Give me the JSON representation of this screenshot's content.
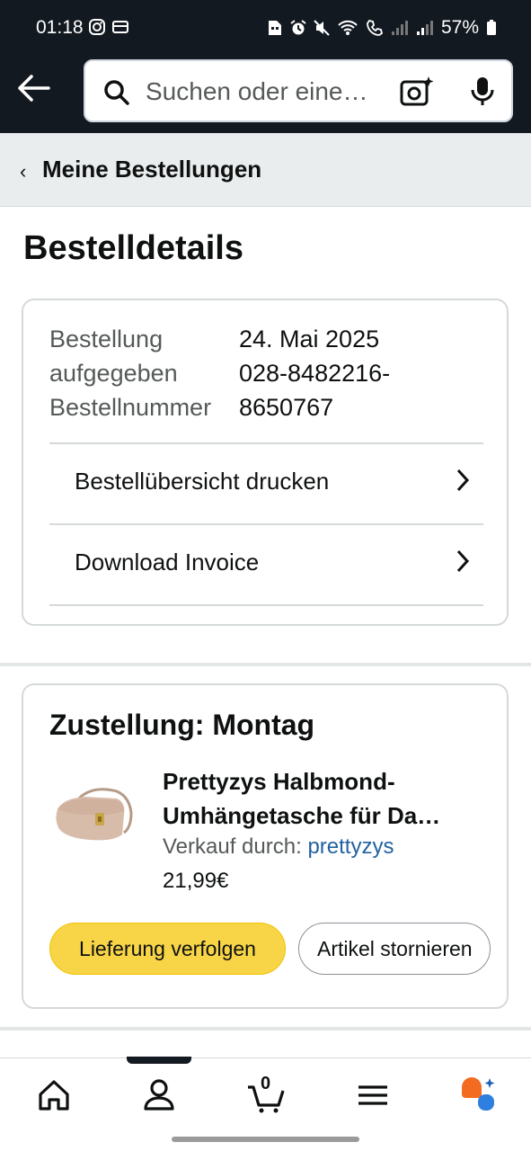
{
  "status_bar": {
    "time": "01:18",
    "battery": "57%"
  },
  "search": {
    "placeholder": "Suchen oder eine…"
  },
  "breadcrumb": {
    "label": "Meine Bestellungen"
  },
  "page": {
    "title": "Bestelldetails"
  },
  "order": {
    "label_placed_1": "Bestellung",
    "label_placed_2": "aufgegeben",
    "label_number": "Bestellnummer",
    "date": "24. Mai 2025",
    "number_1": "028-8482216-",
    "number_2": "8650767",
    "links": [
      {
        "label": "Bestellübersicht drucken"
      },
      {
        "label": "Download Invoice"
      }
    ]
  },
  "delivery": {
    "heading": "Zustellung: Montag",
    "product": {
      "title_line1": "Prettyzys Halbmond-",
      "title_line2": "Umhängetasche für Da…",
      "seller_prefix": "Verkauf durch: ",
      "seller": "prettyzys",
      "price": "21,99€"
    },
    "track_button": "Lieferung verfolgen",
    "cancel_button": "Artikel stornieren"
  },
  "bottom_nav": {
    "cart_count": "0",
    "items": [
      "home-icon",
      "account-icon",
      "cart-icon",
      "menu-icon",
      "assistant-icon"
    ]
  },
  "colors": {
    "header_bg": "#131921",
    "button_yellow": "#f7d547",
    "link_blue": "#2162a1"
  }
}
